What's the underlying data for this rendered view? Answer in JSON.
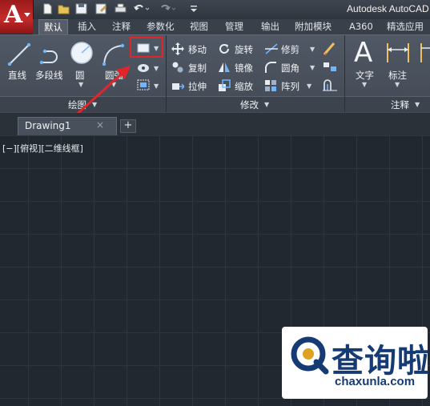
{
  "app_title": "Autodesk AutoCAD",
  "ribbon_tabs": [
    "默认",
    "插入",
    "注释",
    "参数化",
    "视图",
    "管理",
    "输出",
    "附加模块",
    "A360",
    "精选应用"
  ],
  "draw_panel": {
    "tools": [
      "直线",
      "多段线",
      "圆",
      "圆弧"
    ],
    "title": "绘图"
  },
  "modify_panel": {
    "title": "修改",
    "tools": [
      "移动",
      "旋转",
      "修剪",
      "复制",
      "镜像",
      "圆角",
      "拉伸",
      "缩放",
      "阵列"
    ]
  },
  "annotation_panel": {
    "title": "注释",
    "tools": [
      "文字",
      "标注"
    ]
  },
  "document": {
    "tab_title": "Drawing1",
    "close_glyph": "×",
    "new_tab_glyph": "+"
  },
  "viewport_label": "[−][俯视][二维线框]",
  "watermark": {
    "brand": "查询啦",
    "url": "chaxunla.com"
  },
  "colors": {
    "background": "#212830",
    "ribbon": "#4a525d",
    "highlight": "#e0262b",
    "app_red": "#c52b2b",
    "watermark_blue": "#163a74"
  }
}
